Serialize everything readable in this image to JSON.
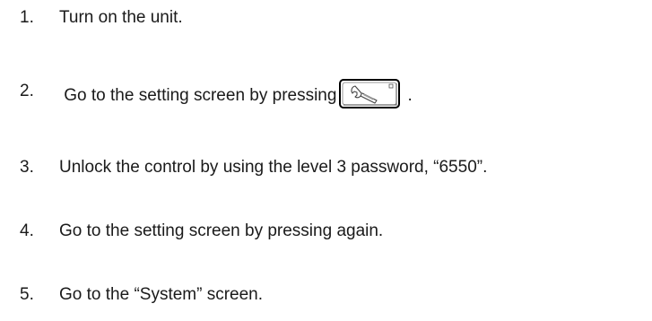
{
  "steps": [
    {
      "number": "1.",
      "text": "Turn on the unit."
    },
    {
      "number": "2.",
      "text": " Go to the setting screen by pressing",
      "suffix": ".",
      "icon": "wrench-icon"
    },
    {
      "number": "3.",
      "text": "Unlock the control by using the level 3 password, “6550”."
    },
    {
      "number": "4.",
      "text": "Go to the setting screen by pressing again."
    },
    {
      "number": "5.",
      "text": "Go to the “System” screen."
    }
  ]
}
